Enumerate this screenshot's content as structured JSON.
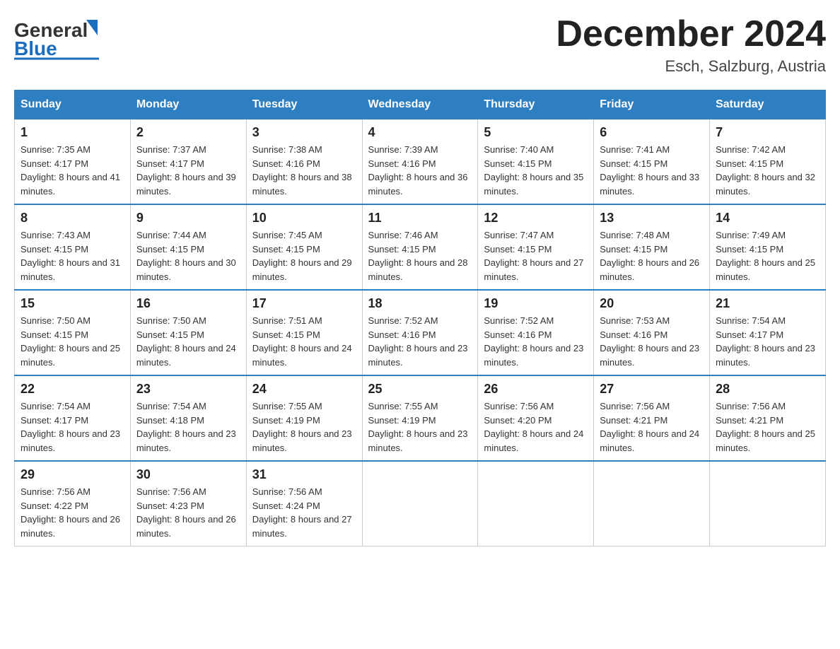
{
  "header": {
    "logo_general": "General",
    "logo_blue": "Blue",
    "month_title": "December 2024",
    "location": "Esch, Salzburg, Austria"
  },
  "weekdays": [
    "Sunday",
    "Monday",
    "Tuesday",
    "Wednesday",
    "Thursday",
    "Friday",
    "Saturday"
  ],
  "weeks": [
    [
      {
        "day": "1",
        "sunrise": "7:35 AM",
        "sunset": "4:17 PM",
        "daylight": "8 hours and 41 minutes."
      },
      {
        "day": "2",
        "sunrise": "7:37 AM",
        "sunset": "4:17 PM",
        "daylight": "8 hours and 39 minutes."
      },
      {
        "day": "3",
        "sunrise": "7:38 AM",
        "sunset": "4:16 PM",
        "daylight": "8 hours and 38 minutes."
      },
      {
        "day": "4",
        "sunrise": "7:39 AM",
        "sunset": "4:16 PM",
        "daylight": "8 hours and 36 minutes."
      },
      {
        "day": "5",
        "sunrise": "7:40 AM",
        "sunset": "4:15 PM",
        "daylight": "8 hours and 35 minutes."
      },
      {
        "day": "6",
        "sunrise": "7:41 AM",
        "sunset": "4:15 PM",
        "daylight": "8 hours and 33 minutes."
      },
      {
        "day": "7",
        "sunrise": "7:42 AM",
        "sunset": "4:15 PM",
        "daylight": "8 hours and 32 minutes."
      }
    ],
    [
      {
        "day": "8",
        "sunrise": "7:43 AM",
        "sunset": "4:15 PM",
        "daylight": "8 hours and 31 minutes."
      },
      {
        "day": "9",
        "sunrise": "7:44 AM",
        "sunset": "4:15 PM",
        "daylight": "8 hours and 30 minutes."
      },
      {
        "day": "10",
        "sunrise": "7:45 AM",
        "sunset": "4:15 PM",
        "daylight": "8 hours and 29 minutes."
      },
      {
        "day": "11",
        "sunrise": "7:46 AM",
        "sunset": "4:15 PM",
        "daylight": "8 hours and 28 minutes."
      },
      {
        "day": "12",
        "sunrise": "7:47 AM",
        "sunset": "4:15 PM",
        "daylight": "8 hours and 27 minutes."
      },
      {
        "day": "13",
        "sunrise": "7:48 AM",
        "sunset": "4:15 PM",
        "daylight": "8 hours and 26 minutes."
      },
      {
        "day": "14",
        "sunrise": "7:49 AM",
        "sunset": "4:15 PM",
        "daylight": "8 hours and 25 minutes."
      }
    ],
    [
      {
        "day": "15",
        "sunrise": "7:50 AM",
        "sunset": "4:15 PM",
        "daylight": "8 hours and 25 minutes."
      },
      {
        "day": "16",
        "sunrise": "7:50 AM",
        "sunset": "4:15 PM",
        "daylight": "8 hours and 24 minutes."
      },
      {
        "day": "17",
        "sunrise": "7:51 AM",
        "sunset": "4:15 PM",
        "daylight": "8 hours and 24 minutes."
      },
      {
        "day": "18",
        "sunrise": "7:52 AM",
        "sunset": "4:16 PM",
        "daylight": "8 hours and 23 minutes."
      },
      {
        "day": "19",
        "sunrise": "7:52 AM",
        "sunset": "4:16 PM",
        "daylight": "8 hours and 23 minutes."
      },
      {
        "day": "20",
        "sunrise": "7:53 AM",
        "sunset": "4:16 PM",
        "daylight": "8 hours and 23 minutes."
      },
      {
        "day": "21",
        "sunrise": "7:54 AM",
        "sunset": "4:17 PM",
        "daylight": "8 hours and 23 minutes."
      }
    ],
    [
      {
        "day": "22",
        "sunrise": "7:54 AM",
        "sunset": "4:17 PM",
        "daylight": "8 hours and 23 minutes."
      },
      {
        "day": "23",
        "sunrise": "7:54 AM",
        "sunset": "4:18 PM",
        "daylight": "8 hours and 23 minutes."
      },
      {
        "day": "24",
        "sunrise": "7:55 AM",
        "sunset": "4:19 PM",
        "daylight": "8 hours and 23 minutes."
      },
      {
        "day": "25",
        "sunrise": "7:55 AM",
        "sunset": "4:19 PM",
        "daylight": "8 hours and 23 minutes."
      },
      {
        "day": "26",
        "sunrise": "7:56 AM",
        "sunset": "4:20 PM",
        "daylight": "8 hours and 24 minutes."
      },
      {
        "day": "27",
        "sunrise": "7:56 AM",
        "sunset": "4:21 PM",
        "daylight": "8 hours and 24 minutes."
      },
      {
        "day": "28",
        "sunrise": "7:56 AM",
        "sunset": "4:21 PM",
        "daylight": "8 hours and 25 minutes."
      }
    ],
    [
      {
        "day": "29",
        "sunrise": "7:56 AM",
        "sunset": "4:22 PM",
        "daylight": "8 hours and 26 minutes."
      },
      {
        "day": "30",
        "sunrise": "7:56 AM",
        "sunset": "4:23 PM",
        "daylight": "8 hours and 26 minutes."
      },
      {
        "day": "31",
        "sunrise": "7:56 AM",
        "sunset": "4:24 PM",
        "daylight": "8 hours and 27 minutes."
      },
      null,
      null,
      null,
      null
    ]
  ]
}
